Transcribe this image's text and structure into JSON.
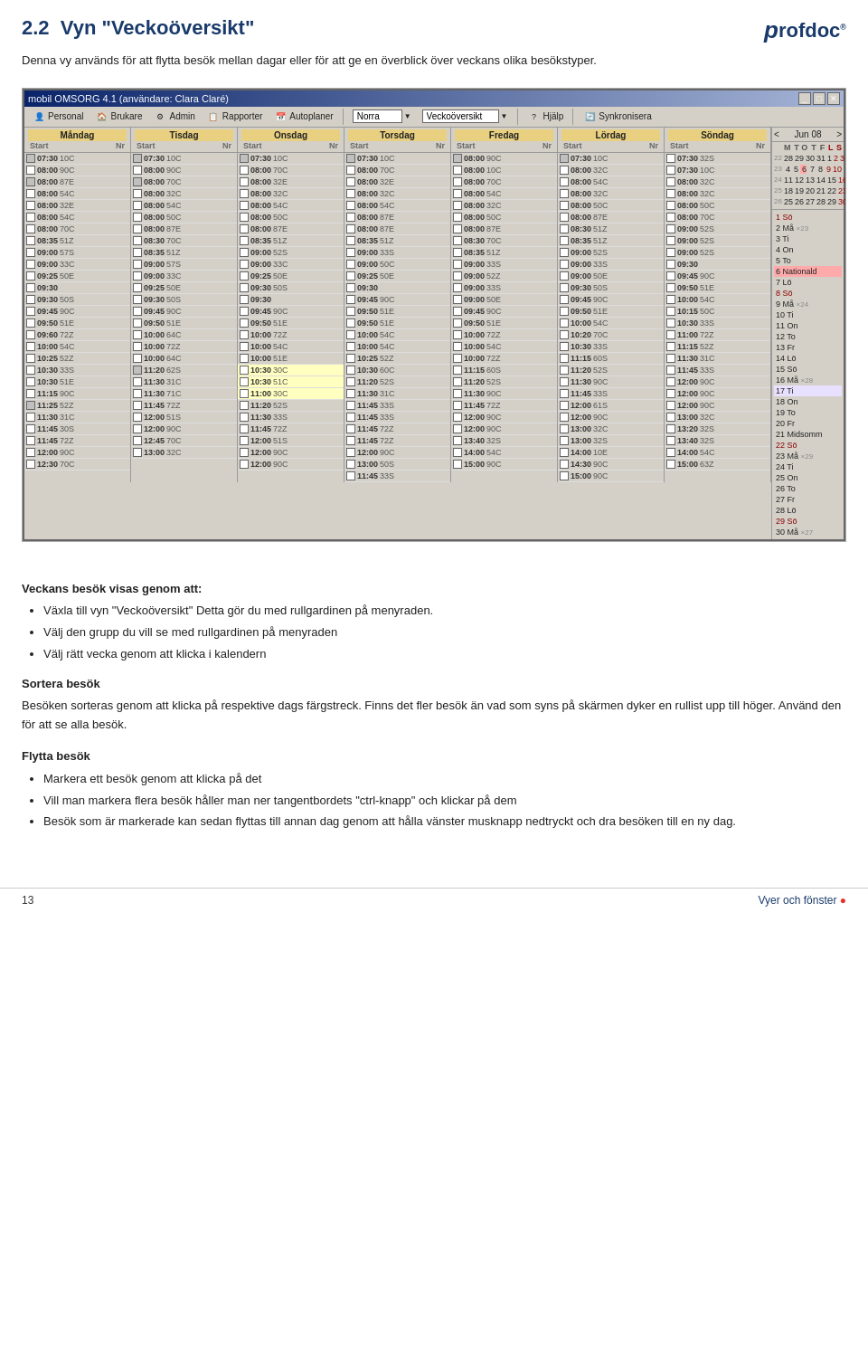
{
  "header": {
    "section": "2.2",
    "title": "Vyn \"Veckoöversikt\"",
    "subtitle": "Denna vy används för att flytta besök mellan dagar eller för att ge en överblick över veckans olika besökstyper.",
    "logo": "profdoc"
  },
  "app_window": {
    "title": "mobil OMSORG 4.1 (användare: Clara Claré)",
    "menu": {
      "personal": "Personal",
      "brukare": "Brukare",
      "admin": "Admin",
      "rapporter": "Rapporter",
      "autoplaner": "Autoplaner",
      "group_field": "Norra",
      "view_field": "Veckoöversikt",
      "hjalp": "Hjälp",
      "synkronisera": "Synkronisera"
    },
    "calendar": {
      "month": "Jun 08",
      "days": [
        "Måndag",
        "Tisdag",
        "Onsdag",
        "Torsdag",
        "Fredag",
        "Lördag",
        "Söndag"
      ]
    }
  },
  "veckans_besok": {
    "title": "Veckans besök visas genom att:",
    "points": [
      "Växla till vyn \"Veckoöversikt\" Detta gör du med rullgardinen på menyraden.",
      "Välj den grupp du vill se med rullgardinen på menyraden",
      "Välj rätt vecka genom att klicka i kalendern"
    ]
  },
  "sortera_besok": {
    "title": "Sortera besök",
    "text": "Besöken sorteras genom att klicka på respektive dags färgstreck. Finns det fler besök  än vad som syns på skärmen dyker en rullist upp till höger. Använd den för att se alla besök."
  },
  "flytta_besok": {
    "title": "Flytta besök",
    "points": [
      "Markera ett besök genom att klicka på det",
      "Vill man markera flera besök håller man ner tangentbordets \"ctrl-knapp\" och klickar på dem",
      "Besök som är markerade kan sedan flyttas till annan dag genom att hålla vänster musknapp nedtryckt och dra besöken till en ny dag."
    ]
  },
  "footer": {
    "page": "13",
    "right_text": "Vyer och fönster"
  }
}
